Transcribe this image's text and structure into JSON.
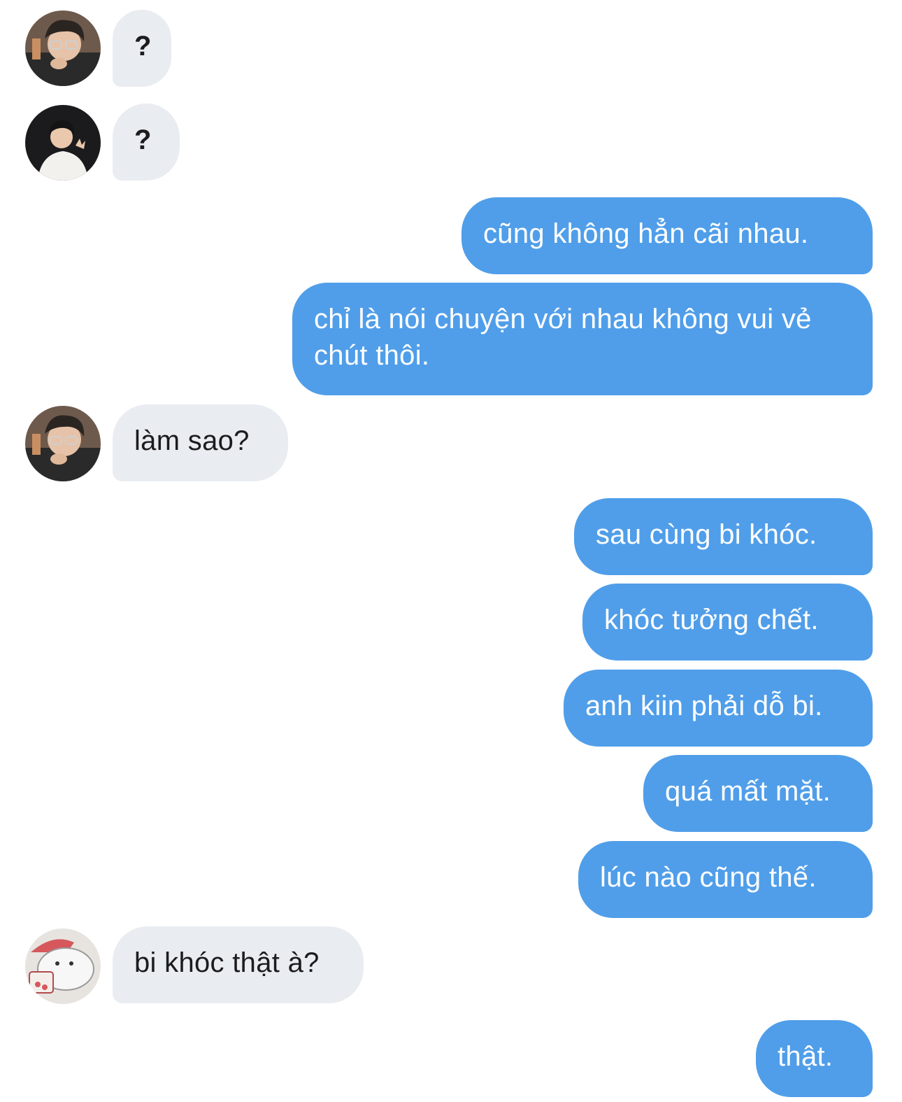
{
  "chat": {
    "colors": {
      "incoming_bubble": "#e9ecf0",
      "outgoing_bubble": "#509ee9",
      "incoming_text": "#1c1c1e",
      "outgoing_text": "#ffffff"
    },
    "messages": [
      {
        "direction": "incoming",
        "avatar": "avatar-glasses-guy",
        "text": "?"
      },
      {
        "direction": "incoming",
        "avatar": "avatar-white-shirt-guy",
        "text": "?"
      },
      {
        "direction": "outgoing",
        "text": "cũng không hẳn cãi nhau."
      },
      {
        "direction": "outgoing",
        "text": "chỉ là nói chuyện với nhau không vui vẻ chút thôi."
      },
      {
        "direction": "incoming",
        "avatar": "avatar-glasses-guy",
        "text": "làm sao?"
      },
      {
        "direction": "outgoing",
        "text": "sau cùng bi khóc."
      },
      {
        "direction": "outgoing",
        "text": "khóc tưởng chết."
      },
      {
        "direction": "outgoing",
        "text": "anh kiin phải dỗ bi."
      },
      {
        "direction": "outgoing",
        "text": "quá mất mặt."
      },
      {
        "direction": "outgoing",
        "text": "lúc nào cũng thế."
      },
      {
        "direction": "incoming",
        "avatar": "avatar-cartoon-seal",
        "text": "bi khóc thật à?"
      },
      {
        "direction": "outgoing",
        "text": "thật."
      }
    ]
  }
}
